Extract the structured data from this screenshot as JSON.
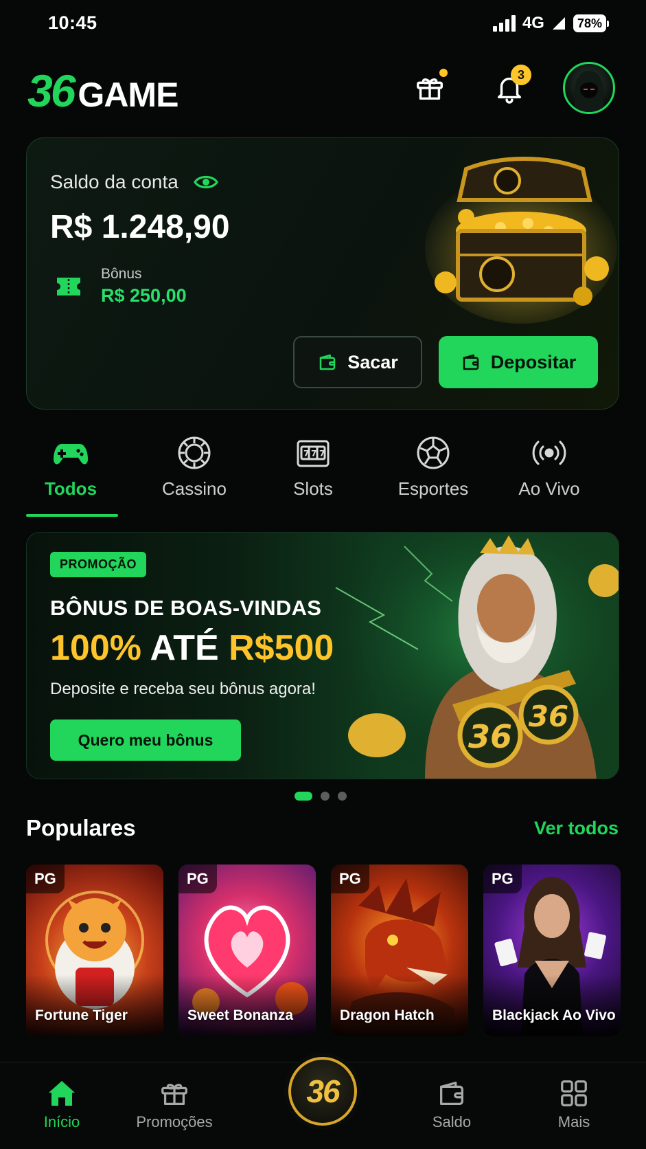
{
  "status_bar": {
    "time": "10:45",
    "network": "4G",
    "battery": "78%"
  },
  "header": {
    "logo_number": "36",
    "logo_text": "GAME",
    "notification_count": "3"
  },
  "balance": {
    "label": "Saldo da conta",
    "amount": "R$ 1.248,90",
    "bonus_label": "Bônus",
    "bonus_amount": "R$ 250,00",
    "withdraw_label": "Sacar",
    "deposit_label": "Depositar"
  },
  "categories": [
    {
      "label": "Todos",
      "icon": "gamepad-icon",
      "active": true
    },
    {
      "label": "Cassino",
      "icon": "poker-chip-icon",
      "active": false
    },
    {
      "label": "Slots",
      "icon": "slot-machine-icon",
      "active": false
    },
    {
      "label": "Esportes",
      "icon": "soccer-ball-icon",
      "active": false
    },
    {
      "label": "Ao Vivo",
      "icon": "live-broadcast-icon",
      "active": false
    }
  ],
  "promo": {
    "tag": "PROMOÇÃO",
    "headline": "BÔNUS DE BOAS-VINDAS",
    "offer_percent": "100%",
    "offer_mid": " ATÉ ",
    "offer_amount": "R$500",
    "subtitle": "Deposite e receba seu bônus agora!",
    "cta": "Quero meu bônus",
    "carousel_pages": 3,
    "carousel_active": 1
  },
  "popular": {
    "title": "Populares",
    "see_all": "Ver todos",
    "games": [
      {
        "provider": "PG",
        "name": "Fortune Tiger"
      },
      {
        "provider": "PG",
        "name": "Sweet Bonanza"
      },
      {
        "provider": "PG",
        "name": "Dragon Hatch"
      },
      {
        "provider": "PG",
        "name": "Blackjack Ao Vivo"
      }
    ]
  },
  "nav": {
    "home": "Início",
    "promos": "Promoções",
    "center": "36",
    "balance": "Saldo",
    "more": "Mais"
  },
  "colors": {
    "accent": "#22d65b",
    "gold": "#ffc42a",
    "background": "#060807"
  }
}
